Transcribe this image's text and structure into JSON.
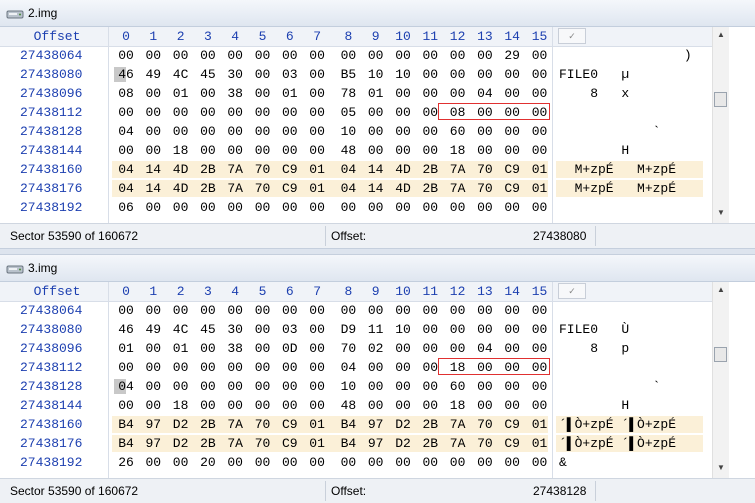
{
  "columns": [
    "0",
    "1",
    "2",
    "3",
    "4",
    "5",
    "6",
    "7",
    "8",
    "9",
    "10",
    "11",
    "12",
    "13",
    "14",
    "15"
  ],
  "offset_label": "Offset",
  "panes": [
    {
      "title": "2.img",
      "status_sector": "Sector 53590 of 160672",
      "status_offset_label": "Offset:",
      "status_offset_value": "27438080",
      "highlight_rows": [
        6,
        7
      ],
      "redbox_row": 3,
      "cursor": {
        "row": 1,
        "col": 0
      },
      "rows": [
        {
          "offset": "27438064",
          "bytes": [
            "00",
            "00",
            "00",
            "00",
            "00",
            "00",
            "00",
            "00",
            "00",
            "00",
            "00",
            "00",
            "00",
            "00",
            "29",
            "00"
          ],
          "ascii": "                )"
        },
        {
          "offset": "27438080",
          "bytes": [
            "46",
            "49",
            "4C",
            "45",
            "30",
            "00",
            "03",
            "00",
            "B5",
            "10",
            "10",
            "00",
            "00",
            "00",
            "00",
            "00"
          ],
          "ascii": "FILE0   µ"
        },
        {
          "offset": "27438096",
          "bytes": [
            "08",
            "00",
            "01",
            "00",
            "38",
            "00",
            "01",
            "00",
            "78",
            "01",
            "00",
            "00",
            "00",
            "04",
            "00",
            "00"
          ],
          "ascii": "    8   x"
        },
        {
          "offset": "27438112",
          "bytes": [
            "00",
            "00",
            "00",
            "00",
            "00",
            "00",
            "00",
            "00",
            "05",
            "00",
            "00",
            "00",
            "08",
            "00",
            "00",
            "00"
          ],
          "ascii": ""
        },
        {
          "offset": "27438128",
          "bytes": [
            "04",
            "00",
            "00",
            "00",
            "00",
            "00",
            "00",
            "00",
            "10",
            "00",
            "00",
            "00",
            "60",
            "00",
            "00",
            "00"
          ],
          "ascii": "            `"
        },
        {
          "offset": "27438144",
          "bytes": [
            "00",
            "00",
            "18",
            "00",
            "00",
            "00",
            "00",
            "00",
            "48",
            "00",
            "00",
            "00",
            "18",
            "00",
            "00",
            "00"
          ],
          "ascii": "        H"
        },
        {
          "offset": "27438160",
          "bytes": [
            "04",
            "14",
            "4D",
            "2B",
            "7A",
            "70",
            "C9",
            "01",
            "04",
            "14",
            "4D",
            "2B",
            "7A",
            "70",
            "C9",
            "01"
          ],
          "ascii": "  M+zpÉ   M+zpÉ"
        },
        {
          "offset": "27438176",
          "bytes": [
            "04",
            "14",
            "4D",
            "2B",
            "7A",
            "70",
            "C9",
            "01",
            "04",
            "14",
            "4D",
            "2B",
            "7A",
            "70",
            "C9",
            "01"
          ],
          "ascii": "  M+zpÉ   M+zpÉ"
        },
        {
          "offset": "27438192",
          "bytes": [
            "06",
            "00",
            "00",
            "00",
            "00",
            "00",
            "00",
            "00",
            "00",
            "00",
            "00",
            "00",
            "00",
            "00",
            "00",
            "00"
          ],
          "ascii": ""
        }
      ]
    },
    {
      "title": "3.img",
      "status_sector": "Sector 53590 of 160672",
      "status_offset_label": "Offset:",
      "status_offset_value": "27438128",
      "highlight_rows": [
        6,
        7
      ],
      "redbox_row": 3,
      "cursor": {
        "row": 4,
        "col": 0
      },
      "rows": [
        {
          "offset": "27438064",
          "bytes": [
            "00",
            "00",
            "00",
            "00",
            "00",
            "00",
            "00",
            "00",
            "00",
            "00",
            "00",
            "00",
            "00",
            "00",
            "00",
            "00"
          ],
          "ascii": ""
        },
        {
          "offset": "27438080",
          "bytes": [
            "46",
            "49",
            "4C",
            "45",
            "30",
            "00",
            "03",
            "00",
            "D9",
            "11",
            "10",
            "00",
            "00",
            "00",
            "00",
            "00"
          ],
          "ascii": "FILE0   Ù"
        },
        {
          "offset": "27438096",
          "bytes": [
            "01",
            "00",
            "01",
            "00",
            "38",
            "00",
            "0D",
            "00",
            "70",
            "02",
            "00",
            "00",
            "00",
            "04",
            "00",
            "00"
          ],
          "ascii": "    8   p"
        },
        {
          "offset": "27438112",
          "bytes": [
            "00",
            "00",
            "00",
            "00",
            "00",
            "00",
            "00",
            "00",
            "04",
            "00",
            "00",
            "00",
            "18",
            "00",
            "00",
            "00"
          ],
          "ascii": ""
        },
        {
          "offset": "27438128",
          "bytes": [
            "04",
            "00",
            "00",
            "00",
            "00",
            "00",
            "00",
            "00",
            "10",
            "00",
            "00",
            "00",
            "60",
            "00",
            "00",
            "00"
          ],
          "ascii": "            `"
        },
        {
          "offset": "27438144",
          "bytes": [
            "00",
            "00",
            "18",
            "00",
            "00",
            "00",
            "00",
            "00",
            "48",
            "00",
            "00",
            "00",
            "18",
            "00",
            "00",
            "00"
          ],
          "ascii": "        H"
        },
        {
          "offset": "27438160",
          "bytes": [
            "B4",
            "97",
            "D2",
            "2B",
            "7A",
            "70",
            "C9",
            "01",
            "B4",
            "97",
            "D2",
            "2B",
            "7A",
            "70",
            "C9",
            "01"
          ],
          "ascii": "´▌Ò+zpÉ ´▌Ò+zpÉ"
        },
        {
          "offset": "27438176",
          "bytes": [
            "B4",
            "97",
            "D2",
            "2B",
            "7A",
            "70",
            "C9",
            "01",
            "B4",
            "97",
            "D2",
            "2B",
            "7A",
            "70",
            "C9",
            "01"
          ],
          "ascii": "´▌Ò+zpÉ ´▌Ò+zpÉ"
        },
        {
          "offset": "27438192",
          "bytes": [
            "26",
            "00",
            "00",
            "20",
            "00",
            "00",
            "00",
            "00",
            "00",
            "00",
            "00",
            "00",
            "00",
            "00",
            "00",
            "00"
          ],
          "ascii": "&"
        }
      ]
    }
  ]
}
